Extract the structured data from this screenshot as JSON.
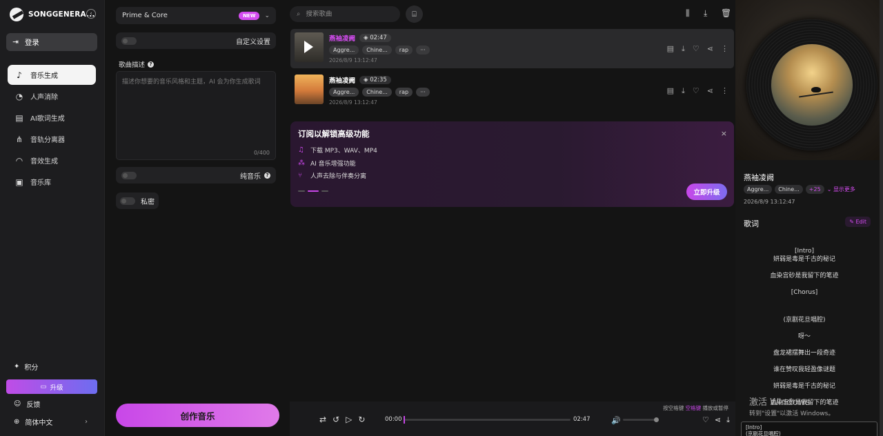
{
  "brand": {
    "name": "SONGGENERA..."
  },
  "sidebar": {
    "login_label": "登录",
    "items": [
      {
        "label": "音乐生成",
        "icon": "music-note-icon",
        "active": true
      },
      {
        "label": "人声消除",
        "icon": "voice-remove-icon"
      },
      {
        "label": "AI歌词生成",
        "icon": "ai-lyrics-icon"
      },
      {
        "label": "音轨分离器",
        "icon": "track-split-icon"
      },
      {
        "label": "音效生成",
        "icon": "sound-effect-icon"
      },
      {
        "label": "音乐库",
        "icon": "library-icon"
      }
    ],
    "points_label": "积分",
    "upgrade_label": "升级",
    "feedback_label": "反馈",
    "language_label": "简体中文"
  },
  "form": {
    "model_label": "Prime & Core",
    "model_badge": "NEW",
    "custom_label": "自定义设置",
    "desc_label": "歌曲描述",
    "desc_placeholder": "描述你想要的音乐风格和主题，AI 会为你生成歌词",
    "counter": "0/400",
    "instrumental_label": "纯音乐",
    "private_label": "私密",
    "create_label": "创作音乐"
  },
  "list": {
    "search_placeholder": "搜索歌曲",
    "songs": [
      {
        "title": "燕袖凌阙",
        "duration": "02:47",
        "tags": [
          "Aggre...",
          "Chine...",
          "rap",
          "···"
        ],
        "date": "2026/8/9 13:12:47"
      },
      {
        "title": "燕袖凌阙",
        "duration": "02:35",
        "tags": [
          "Aggre...",
          "Chine...",
          "rap",
          "···"
        ],
        "date": "2026/8/9 13:12:47"
      }
    ]
  },
  "promo": {
    "title": "订阅以解锁高级功能",
    "features": [
      "下载 MP3、WAV、MP4",
      "AI 音乐增强功能",
      "人声去除与伴奏分离"
    ],
    "button": "立即升级",
    "close": "×"
  },
  "player": {
    "hint_prefix": "按空格键",
    "hint_key": "空格键",
    "hint_suffix": "播放或暂停",
    "current": "00:00",
    "total": "02:47",
    "progress": 0,
    "volume": 1.0
  },
  "right": {
    "title": "燕袖凌阙",
    "tags": [
      "Aggre...",
      "Chine..."
    ],
    "more_count": "+25",
    "show_more": "显示更多",
    "date": "2026/8/9 13:12:47",
    "lyrics_heading": "歌词",
    "edit_label": "Edit",
    "lyrics": [
      "[Intro]",
      "妍弱是毒是千古的秘记",
      "血染宫砂是我留下的笔迹",
      "[Chorus]",
      "(京剧花旦唱腔)",
      "呀～",
      "盘龙裙摆舞出一段奇迹",
      "谁在赞叹我轻盈像谜题",
      "妍弱是毒是千古的秘记",
      "血染宫砂是我留下的笔迹"
    ],
    "lyrics_footer": [
      "[Intro]",
      "(京剧花旦唱腔)"
    ]
  },
  "watermark": {
    "line1": "激活 Windows",
    "line2": "转到\"设置\"以激活 Windows。"
  }
}
